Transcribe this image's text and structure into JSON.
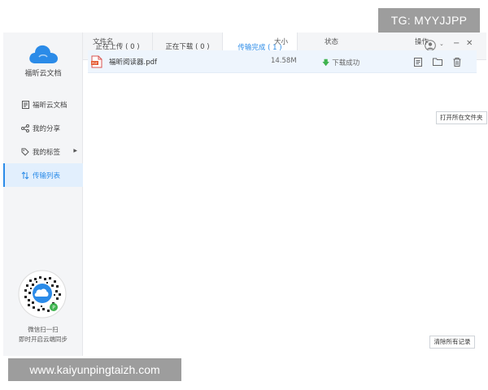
{
  "app": {
    "name": "福昕云文档",
    "brand_color": "#2b8be8"
  },
  "sidebar": {
    "items": [
      {
        "label": "福昕云文档",
        "icon": "document-icon"
      },
      {
        "label": "我的分享",
        "icon": "share-icon"
      },
      {
        "label": "我的标签",
        "icon": "tag-icon",
        "has_submenu": true
      },
      {
        "label": "传输列表",
        "icon": "transfer-icon",
        "active": true
      }
    ],
    "qr_caption_line1": "微信扫一扫",
    "qr_caption_line2": "即时开启云端同步"
  },
  "tabs": [
    {
      "label": "正在上传 ( 0 )"
    },
    {
      "label": "正在下载 ( 0 )"
    },
    {
      "label": "传输完成 ( 1 )",
      "active": true
    }
  ],
  "table": {
    "columns": {
      "name": "文件名",
      "size": "大小",
      "status": "状态",
      "actions": "操作"
    },
    "rows": [
      {
        "name": "福昕阅读器.pdf",
        "size": "14.58M",
        "status": "下载成功",
        "status_color": "#3fb34f"
      }
    ]
  },
  "tooltip": "打开所在文件夹",
  "clear_button": "清除所有记录",
  "watermarks": {
    "top": "TG: MYYJJPP",
    "bottom": "www.kaiyunpingtaizh.com"
  }
}
